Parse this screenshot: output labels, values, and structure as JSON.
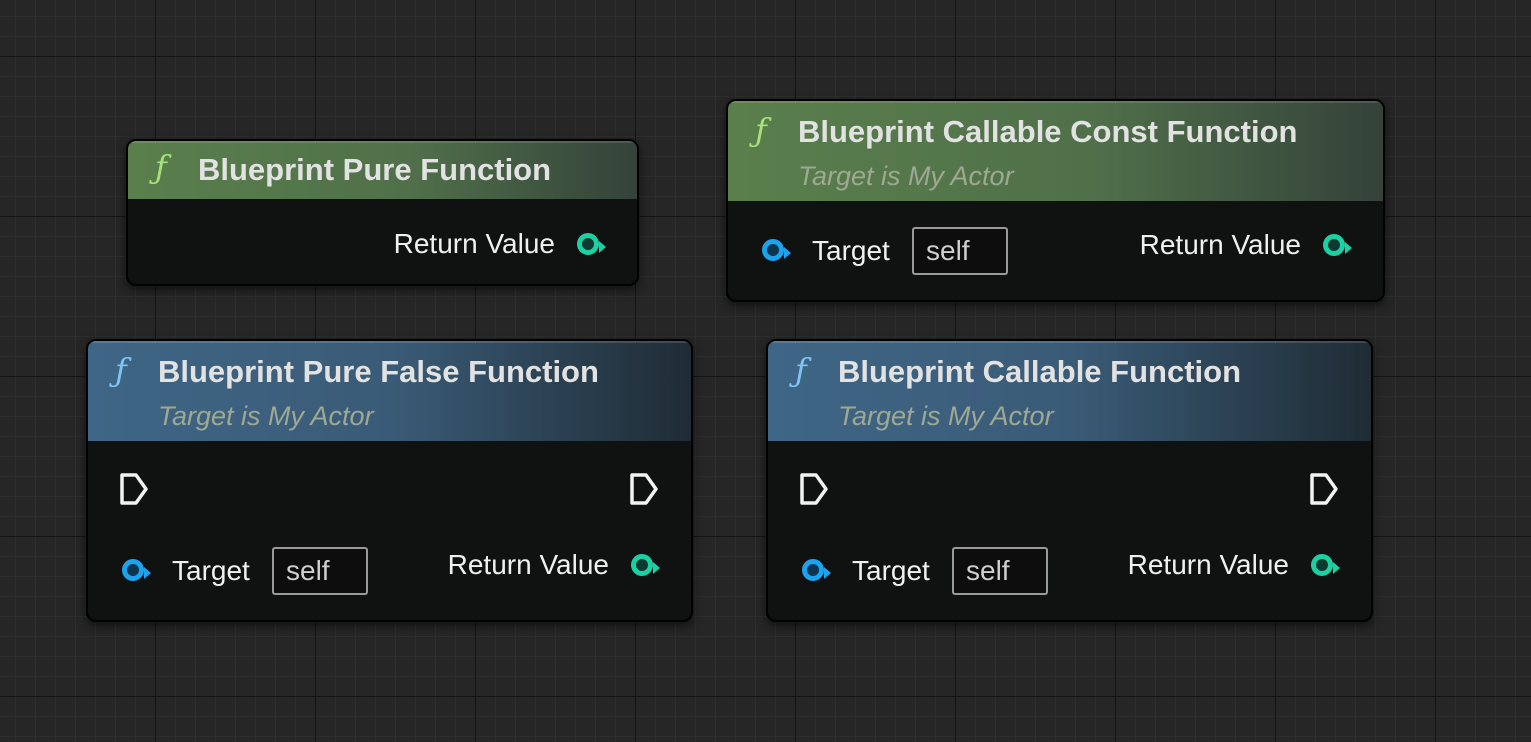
{
  "nodes": {
    "pure": {
      "title": "Blueprint Pure Function",
      "return_label": "Return Value"
    },
    "callable_const": {
      "title": "Blueprint Callable Const Function",
      "subtitle": "Target is My Actor",
      "target_label": "Target",
      "target_value": "self",
      "return_label": "Return Value"
    },
    "pure_false": {
      "title": "Blueprint Pure False Function",
      "subtitle": "Target is My Actor",
      "target_label": "Target",
      "target_value": "self",
      "return_label": "Return Value"
    },
    "callable": {
      "title": "Blueprint Callable Function",
      "subtitle": "Target is My Actor",
      "target_label": "Target",
      "target_value": "self",
      "return_label": "Return Value"
    }
  },
  "icons": {
    "function": "ƒ",
    "exec": "exec-arrow-pin",
    "object_pin": "blue-circle-pin",
    "return_pin": "teal-circle-pin"
  },
  "colors": {
    "pure_header": "#5a7f4c",
    "callable_header": "#3f6686",
    "return_pin": "#1bd1a3",
    "target_pin": "#1da3ee",
    "pure_icon": "#a8e07a",
    "callable_icon": "#7fc4f5"
  }
}
